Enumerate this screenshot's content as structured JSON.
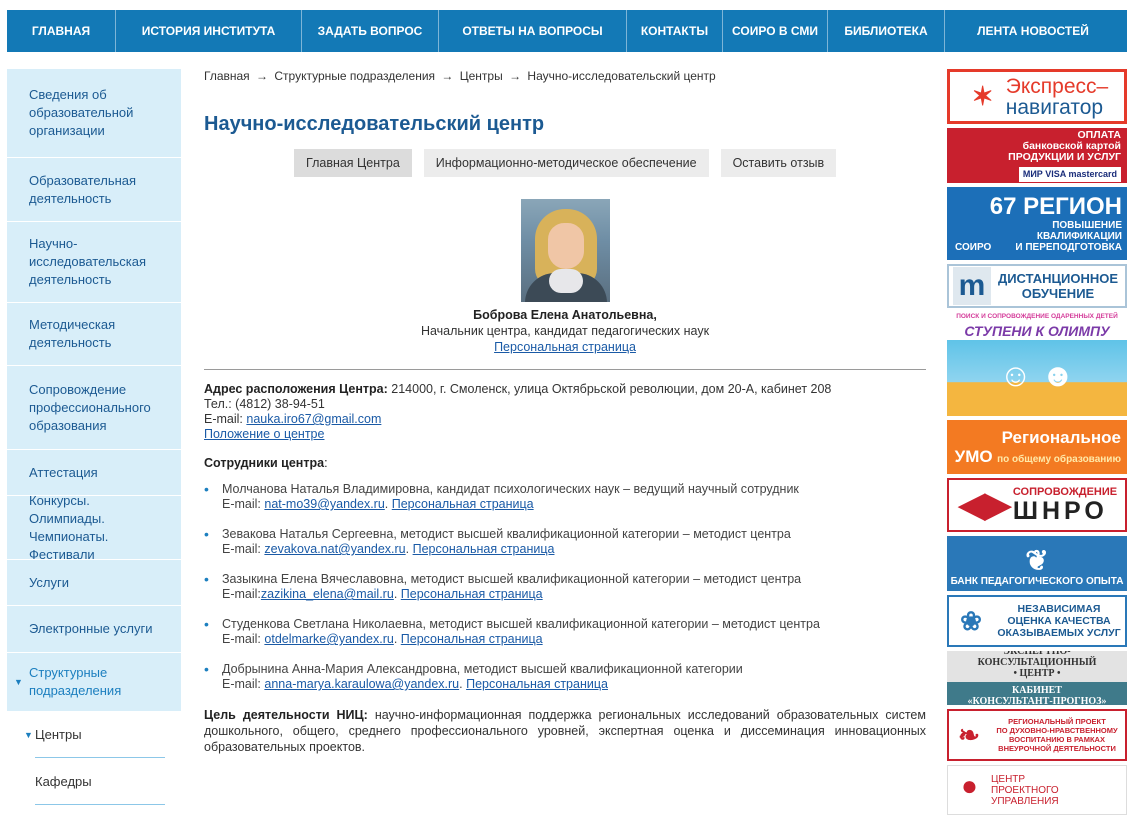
{
  "topnav": {
    "items": [
      {
        "label": "ГЛАВНАЯ"
      },
      {
        "label": "ИСТОРИЯ ИНСТИТУТА"
      },
      {
        "label": "ЗАДАТЬ ВОПРОС"
      },
      {
        "label": "ОТВЕТЫ НА ВОПРОСЫ"
      },
      {
        "label": "КОНТАКТЫ"
      },
      {
        "label": "СОИРО В СМИ"
      },
      {
        "label": "БИБЛИОТЕКА"
      },
      {
        "label": "ЛЕНТА НОВОСТЕЙ"
      }
    ]
  },
  "sidebar": {
    "items": [
      {
        "label": "Сведения об образовательной организации"
      },
      {
        "label": "Образовательная деятельность"
      },
      {
        "label": "Научно-исследовательская деятельность"
      },
      {
        "label": "Методическая деятельность"
      },
      {
        "label": "Сопровождение профессионального образования"
      },
      {
        "label": "Аттестация"
      },
      {
        "label": "Конкурсы. Олимпиады. Чемпионаты. Фестивали"
      },
      {
        "label": "Услуги"
      },
      {
        "label": "Электронные услуги"
      },
      {
        "label": "Структурные подразделения"
      }
    ],
    "sub_items": [
      {
        "label": "Центры"
      },
      {
        "label": "Кафедры"
      }
    ]
  },
  "breadcrumb": {
    "items": [
      "Главная",
      "Структурные подразделения",
      "Центры",
      "Научно-исследовательский центр"
    ],
    "separator": "→"
  },
  "page": {
    "title": "Научно-исследовательский центр"
  },
  "tabs": [
    {
      "label": "Главная Центра"
    },
    {
      "label": "Информационно-методическое обеспечение"
    },
    {
      "label": "Оставить отзыв"
    }
  ],
  "head": {
    "name": "Боброва Елена Анатольевна,",
    "position": "Начальник центра, кандидат педагогических наук",
    "link": "Персональная страница"
  },
  "contacts": {
    "address_label": "Адрес расположения Центра:",
    "address": "214000, г. Смоленск, улица Октябрьской революции, дом 20-А, кабинет 208",
    "phone": "Тел.: (4812) 38-94-51",
    "email_label": "E-mail:",
    "email": "nauka.iro67@gmail.com",
    "regulation_link": "Положение о центре"
  },
  "staff": {
    "heading": "Сотрудники центра",
    "heading_suffix": ":",
    "email_label": "E-mail:",
    "page_link": "Персональная страница",
    "members": [
      {
        "text": "Молчанова Наталья Владимировна, кандидат психологических наук – ведущий научный сотрудник",
        "email": "nat-mo39@yandex.ru"
      },
      {
        "text": "Зевакова Наталья Сергеевна, методист высшей квалификационной категории – методист центра",
        "email": "zevakova.nat@yandex.ru"
      },
      {
        "text": "Зазыкина Елена Вячеславовна, методист высшей квалификационной категории – методист центра",
        "email": "zazikina_elena@mail.ru"
      },
      {
        "text": "Студенкова Светлана Николаевна, методист высшей квалификационной категории – методист центра",
        "email": "otdelmarke@yandex.ru"
      },
      {
        "text": "Добрынина Анна-Мария Александровна, методист высшей квалификационной категории",
        "email": "anna-marya.karaulowa@yandex.ru"
      }
    ]
  },
  "goal": {
    "label": "Цель деятельности НИЦ:",
    "text": "научно-информационная поддержка региональных исследований образовательных систем дошкольного, общего, среднего профессионального уровней, экспертная оценка и диссеминация инновационных образовательных проектов."
  },
  "banners": {
    "express": {
      "line1": "Экспресс–",
      "line2": "навигатор"
    },
    "pay": {
      "line1": "ОПЛАТА",
      "line2": "банковской картой",
      "line3": "ПРОДУКЦИИ И УСЛУГ",
      "cards": "МИР VISA mastercard"
    },
    "region": {
      "big": "67 РЕГИОН",
      "line1": "ПОВЫШЕНИЕ",
      "line2": "КВАЛИФИКАЦИИ",
      "line3": "И ПЕРЕПОДГОТОВКА",
      "brand": "СОИРО"
    },
    "moodle": {
      "line1": "ДИСТАНЦИОННОЕ",
      "line2": "ОБУЧЕНИЕ",
      "brand": "moodle"
    },
    "olymp": {
      "top": "ПОИСК И СОПРОВОЖДЕНИЕ ОДАРЕННЫХ ДЕТЕЙ",
      "title": "СТУПЕНИ К ОЛИМПУ"
    },
    "umo": {
      "line1": "Региональное",
      "line2": "УМО",
      "small": "по общему образованию"
    },
    "shnro": {
      "line1": "СОПРОВОЖДЕНИЕ",
      "line2": "ШНРО"
    },
    "bank": {
      "text": "БАНК ПЕДАГОГИЧЕСКОГО ОПЫТА"
    },
    "indep": {
      "line1": "НЕЗАВИСИМАЯ",
      "line2": "ОЦЕНКА КАЧЕСТВА",
      "line3": "ОКАЗЫВАЕМЫХ УСЛУГ"
    },
    "expert": {
      "line1": "ЭКСПЕРТНО-КОНСУЛЬТАЦИОННЫЙ",
      "line2": "• ЦЕНТР •",
      "line3": "КАБИНЕТ",
      "line4": "«КОНСУЛЬТАНТ-ПРОГНОЗ»"
    },
    "spirit": {
      "line1": "РЕГИОНАЛЬНЫЙ ПРОЕКТ",
      "line2": "ПО ДУХОВНО-НРАВСТВЕННОМУ",
      "line3": "ВОСПИТАНИЮ В РАМКАХ",
      "line4": "ВНЕУРОЧНОЙ ДЕЯТЕЛЬНОСТИ"
    },
    "proj": {
      "line1": "ЦЕНТР",
      "line2": "ПРОЕКТНОГО УПРАВЛЕНИЯ"
    }
  },
  "colors": {
    "nav_bg": "#1379b6",
    "sidebar_bg": "#d8eef9",
    "title": "#1c5a92",
    "link": "#1a5aa6"
  }
}
